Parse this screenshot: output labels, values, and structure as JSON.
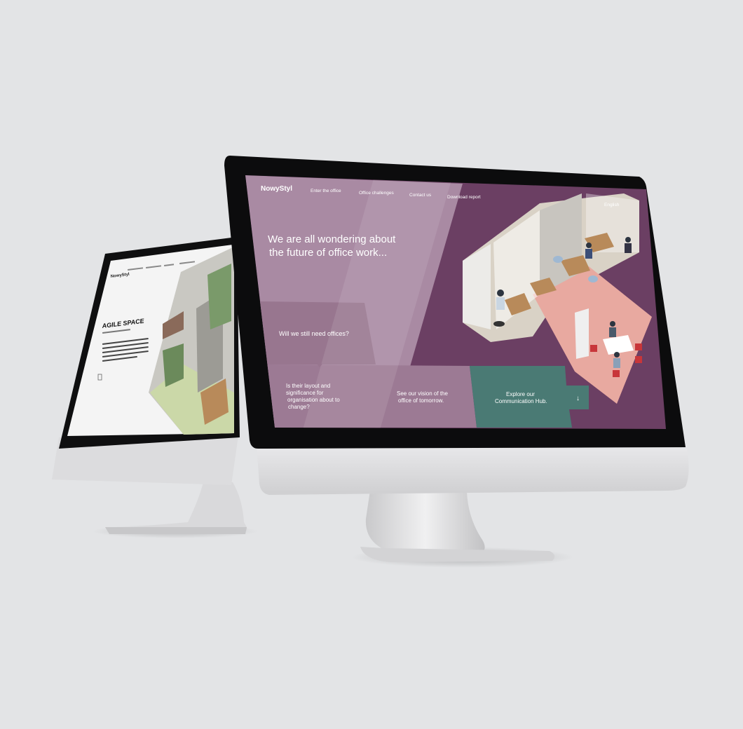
{
  "front_site": {
    "logo": "NowyStyl",
    "nav": [
      "Enter the office",
      "Office challenges",
      "Contact us",
      "Download report"
    ],
    "language": "English",
    "hero_line1": "We are all wondering about",
    "hero_line2": "the future of office work...",
    "question1": "Will we still need offices?",
    "question2_lines": [
      "Is their layout and",
      "significance for",
      "organisation about to",
      "change?"
    ],
    "question3_lines": [
      "See our vision of the",
      "office of tomorrow."
    ],
    "cta_lines": [
      "Explore our",
      "Communication Hub."
    ],
    "cta_arrow": "↓",
    "colors": {
      "purple_dark": "#6b3f63",
      "purple_mid": "#8f6688",
      "purple_light": "#a98aa3",
      "teal": "#4a7a74"
    }
  },
  "back_site": {
    "logo": "NowyStyl",
    "heading": "AGILE SPACE"
  }
}
